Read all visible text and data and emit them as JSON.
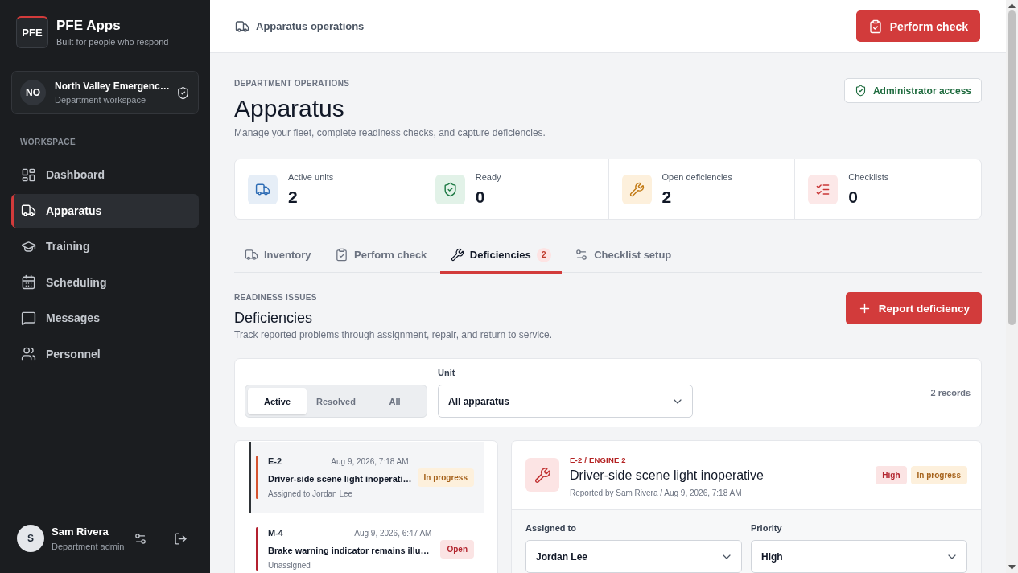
{
  "sidebar": {
    "logo": "PFE",
    "brand": "PFE Apps",
    "tagline": "Built for people who respond",
    "workspace": {
      "initials": "NO",
      "name": "North Valley Emergenc…",
      "subtitle": "Department workspace"
    },
    "section_label": "WORKSPACE",
    "nav": [
      {
        "label": "Dashboard",
        "selected": false
      },
      {
        "label": "Apparatus",
        "selected": true
      },
      {
        "label": "Training",
        "selected": false
      },
      {
        "label": "Scheduling",
        "selected": false
      },
      {
        "label": "Messages",
        "selected": false
      },
      {
        "label": "Personnel",
        "selected": false
      }
    ],
    "user": {
      "initial": "S",
      "name": "Sam Rivera",
      "role": "Department admin"
    }
  },
  "header": {
    "title": "Apparatus operations",
    "action": "Perform check"
  },
  "page": {
    "eyebrow": "DEPARTMENT OPERATIONS",
    "title": "Apparatus",
    "subtitle": "Manage your fleet, complete readiness checks, and capture deficiencies.",
    "access": "Administrator access"
  },
  "stats": [
    {
      "label": "Active units",
      "value": "2"
    },
    {
      "label": "Ready",
      "value": "0"
    },
    {
      "label": "Open deficiencies",
      "value": "2"
    },
    {
      "label": "Checklists",
      "value": "0"
    }
  ],
  "tabs": [
    {
      "label": "Inventory",
      "selected": false
    },
    {
      "label": "Perform check",
      "selected": false
    },
    {
      "label": "Deficiencies",
      "selected": true,
      "badge": "2"
    },
    {
      "label": "Checklist setup",
      "selected": false
    }
  ],
  "section": {
    "eyebrow": "READINESS ISSUES",
    "title": "Deficiencies",
    "subtitle": "Track reported problems through assignment, repair, and return to service.",
    "action": "Report deficiency"
  },
  "filters": {
    "segments": [
      {
        "label": "Active",
        "selected": true
      },
      {
        "label": "Resolved",
        "selected": false
      },
      {
        "label": "All",
        "selected": false
      }
    ],
    "unit": {
      "label": "Unit",
      "value": "All apparatus"
    },
    "count": "2 records"
  },
  "deficiencies": [
    {
      "unit": "E-2",
      "date": "Aug 9, 2026, 7:18 AM",
      "title": "Driver-side scene light inoperati…",
      "assignee": "Assigned to Jordan Lee",
      "status": {
        "label": "In progress",
        "kind": "in_progress"
      },
      "color": "#d4522f",
      "selected": true
    },
    {
      "unit": "M-4",
      "date": "Aug 9, 2026, 6:47 AM",
      "title": "Brake warning indicator remains illu…",
      "assignee": "Unassigned",
      "status": {
        "label": "Open",
        "kind": "open"
      },
      "color": "#b3202f",
      "selected": false
    }
  ],
  "detail": {
    "unit": "E-2 / ENGINE 2",
    "title": "Driver-side scene light inoperative",
    "meta": "Reported by Sam Rivera / Aug 9, 2026, 7:18 AM",
    "badges": [
      {
        "label": "High",
        "kind": "high"
      },
      {
        "label": "In progress",
        "kind": "in_progress"
      }
    ],
    "fields": [
      {
        "label": "Assigned to",
        "value": "Jordan Lee"
      },
      {
        "label": "Priority",
        "value": "High"
      }
    ]
  }
}
